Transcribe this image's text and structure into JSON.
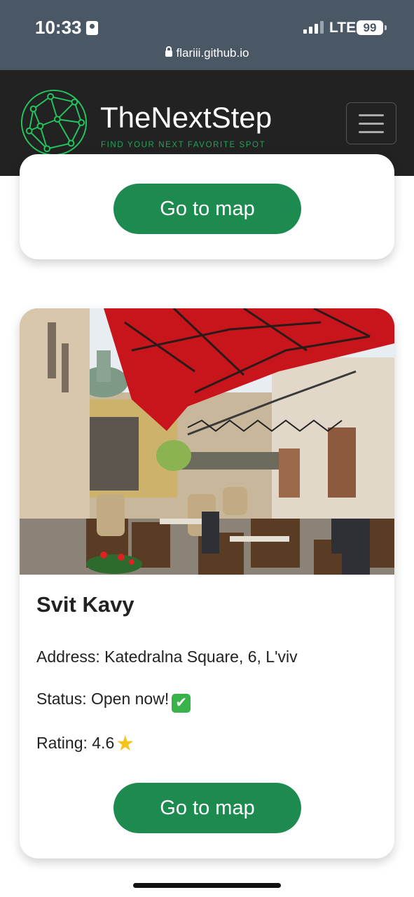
{
  "status_bar": {
    "time": "10:33",
    "network": "LTE",
    "battery": "99",
    "url": "flariii.github.io"
  },
  "navbar": {
    "brand": "TheNextStep",
    "tagline": "FIND YOUR NEXT FAVORITE SPOT",
    "menu_icon": "hamburger-icon"
  },
  "cards": [
    {
      "button_label": "Go to map"
    },
    {
      "name": "Svit Kavy",
      "address": "Address: Katedralna Square, 6, L'viv",
      "status": "Status: Open now!",
      "status_icon": "✔",
      "rating": "Rating: 4.6",
      "rating_icon": "★",
      "button_label": "Go to map"
    }
  ],
  "colors": {
    "accent": "#1d8a4f",
    "navbar": "#222222",
    "tagline": "#1fa35a",
    "awning": "#c8141b"
  }
}
